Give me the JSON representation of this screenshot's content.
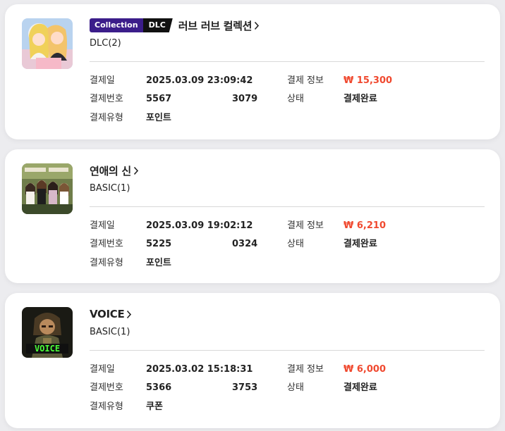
{
  "orders": [
    {
      "thumbnail_icon": "game-cover-two-anime-women",
      "tags": {
        "collection": "Collection",
        "dlc": "DLC"
      },
      "title": "러브 러브 컬렉션",
      "subtitle": "DLC(2)",
      "labels": {
        "date": "결제일",
        "number": "결제번호",
        "type": "결제유형",
        "pay_info": "결제 정보",
        "status": "상태"
      },
      "date": "2025.03.09 23:09:42",
      "number_start": "5567",
      "number_end": "3079",
      "price": "₩ 15,300",
      "status": "결제완료",
      "payment_type": "포인트"
    },
    {
      "thumbnail_icon": "game-cover-group-of-women",
      "title": "연애의 신",
      "subtitle": "BASIC(1)",
      "labels": {
        "date": "결제일",
        "number": "결제번호",
        "type": "결제유형",
        "pay_info": "결제 정보",
        "status": "상태"
      },
      "date": "2025.03.09 19:02:12",
      "number_start": "5225",
      "number_end": "0324",
      "price": "₩ 6,210",
      "status": "결제완료",
      "payment_type": "포인트"
    },
    {
      "thumbnail_icon": "game-cover-pixel-soldier",
      "title": "VOICE",
      "subtitle": "BASIC(1)",
      "labels": {
        "date": "결제일",
        "number": "결제번호",
        "type": "결제유형",
        "pay_info": "결제 정보",
        "status": "상태"
      },
      "date": "2025.03.02 15:18:31",
      "number_start": "5366",
      "number_end": "3753",
      "price": "₩ 6,000",
      "status": "결제완료",
      "payment_type": "쿠폰"
    }
  ],
  "colors": {
    "price": "#f0492f",
    "collection_tag": "#3b1d8a",
    "dlc_tag": "#111111"
  }
}
